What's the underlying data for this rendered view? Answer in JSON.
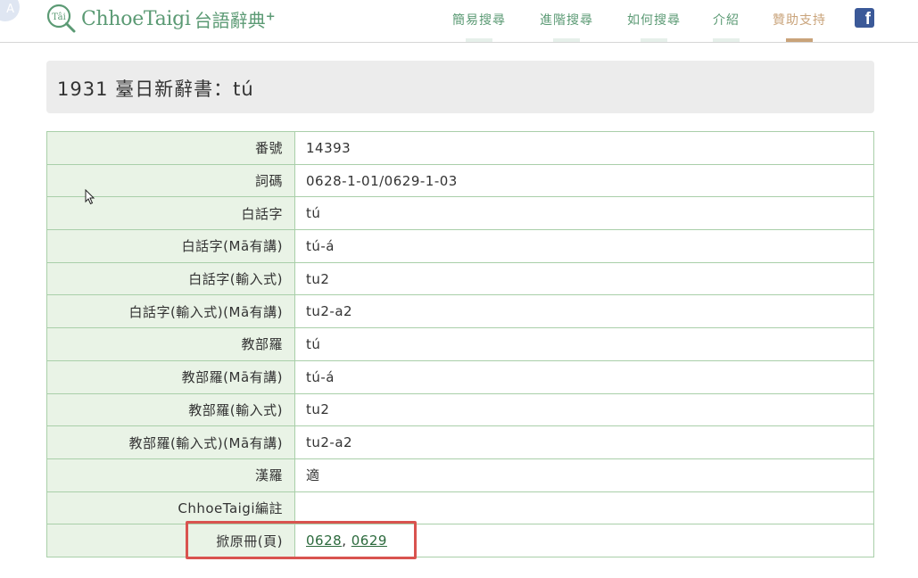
{
  "corner_badge": "A",
  "brand": {
    "logo_text": "Tâi",
    "name": "ChhoeTaigi",
    "cjk": "台語辭典",
    "plus": "+"
  },
  "nav": [
    {
      "label": "簡易搜尋"
    },
    {
      "label": "進階搜尋"
    },
    {
      "label": "如何搜尋"
    },
    {
      "label": "介紹"
    },
    {
      "label": "贊助支持"
    }
  ],
  "facebook_icon": "f",
  "page_title": "1931 臺日新辭書：tú",
  "rows": [
    {
      "key": "番號",
      "value": "14393"
    },
    {
      "key": "詞碼",
      "value": "0628-1-01/0629-1-03"
    },
    {
      "key": "白話字",
      "value": "tú"
    },
    {
      "key": "白話字(Mā有講)",
      "value": "tú-á"
    },
    {
      "key": "白話字(輸入式)",
      "value": "tu2"
    },
    {
      "key": "白話字(輸入式)(Mā有講)",
      "value": "tu2-a2"
    },
    {
      "key": "教部羅",
      "value": "tú"
    },
    {
      "key": "教部羅(Mā有講)",
      "value": "tú-á"
    },
    {
      "key": "教部羅(輸入式)",
      "value": "tu2"
    },
    {
      "key": "教部羅(輸入式)(Mā有講)",
      "value": "tu2-a2"
    },
    {
      "key": "漢羅",
      "value": "適"
    },
    {
      "key": "ChhoeTaigi編註",
      "value": ""
    }
  ],
  "pages_row": {
    "key": "掀原冊(頁)",
    "links": [
      "0628",
      "0629"
    ],
    "separator": ", "
  },
  "colors": {
    "brand_green": "#5b9a74",
    "sponsor_tan": "#c9a37a",
    "key_cell_bg": "#e9f3e6",
    "table_border": "#a9cfa9",
    "highlight_red": "#d9534f"
  }
}
